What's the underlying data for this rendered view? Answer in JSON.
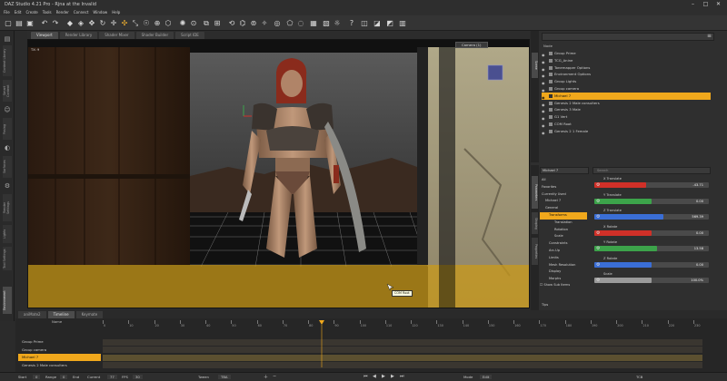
{
  "window": {
    "title": "DAZ Studio 4.21 Pro - Rjna at the Invalid",
    "controls": [
      "–",
      "□",
      "✕"
    ]
  },
  "menu": [
    "File",
    "Edit",
    "Create",
    "Tools",
    "Render",
    "Connect",
    "Window",
    "Help"
  ],
  "toolbar_icons": [
    "new-icon",
    "open-icon",
    "save-icon",
    "undo-icon",
    "redo-icon",
    "daz-icon",
    "lock-icon",
    "select-icon",
    "rotate-icon",
    "universal-icon",
    "translate-icon",
    "scale-icon",
    "pose-icon",
    "joint-icon",
    "geometry-icon",
    "light-icon",
    "camera-icon",
    "render-icon",
    "iray-icon",
    "help-icon"
  ],
  "viewport": {
    "tabs": [
      "Viewport",
      "Render Library",
      "Shader Mixer",
      "Shader Builder",
      "Script IDE"
    ],
    "active_tab": "Viewport",
    "corner_label": "TX: 9",
    "camera_selector": "Camera (1)",
    "tooltip": "COM Root"
  },
  "left_panel_tabs": [
    "Content Library",
    "Smart Content",
    "Posing",
    "Surfaces",
    "Render Settings",
    "Lights",
    "Tool Settings",
    "Environment"
  ],
  "scene": {
    "tab": "Scene",
    "header": "Node",
    "items": [
      {
        "label": "Group Prime",
        "selected": false
      },
      {
        "label": "TCG_Anine",
        "selected": false
      },
      {
        "label": "Tonemapper Options",
        "selected": false
      },
      {
        "label": "Environment Options",
        "selected": false
      },
      {
        "label": "Group Lights",
        "selected": false
      },
      {
        "label": "Group camera",
        "selected": false
      },
      {
        "label": "Michael 7",
        "selected": true
      },
      {
        "label": "Genesis 2 Male consulters",
        "selected": false
      },
      {
        "label": "Genesis 3 Male",
        "selected": false
      },
      {
        "label": "G1 Vert",
        "selected": false
      },
      {
        "label": "COM Root",
        "selected": false
      },
      {
        "label": "Genesis 2 1 Female",
        "selected": false
      }
    ]
  },
  "parameters": {
    "tab": "Parameters",
    "object": "Michael 7",
    "search_placeholder": "Search",
    "nav": [
      {
        "label": "All",
        "selected": false
      },
      {
        "label": "Favorites",
        "selected": false
      },
      {
        "label": "Currently Used",
        "selected": false
      },
      {
        "label": "Michael 7",
        "selected": false
      },
      {
        "label": "General",
        "selected": false
      },
      {
        "label": "Transforms",
        "selected": true
      },
      {
        "label": "Translation",
        "selected": false
      },
      {
        "label": "Rotation",
        "selected": false
      },
      {
        "label": "Scale",
        "selected": false
      },
      {
        "label": "Constraints",
        "selected": false
      },
      {
        "label": "Arc-Up",
        "selected": false
      },
      {
        "label": "Limits",
        "selected": false
      },
      {
        "label": "Mesh Resolution",
        "selected": false
      },
      {
        "label": "Display",
        "selected": false
      },
      {
        "label": "Morphs",
        "selected": false
      }
    ],
    "show_sub_items": "Show Sub Items",
    "props": [
      {
        "label": "X Translate",
        "value": "-43.71",
        "color": "#d03028",
        "fraction": 0.45
      },
      {
        "label": "Y Translate",
        "value": "0.00",
        "color": "#3ca34a",
        "fraction": 0.5
      },
      {
        "label": "Z Translate",
        "value": "569.39",
        "color": "#3a6ed6",
        "fraction": 0.6
      },
      {
        "label": "X Rotate",
        "value": "0.00",
        "color": "#d03028",
        "fraction": 0.5
      },
      {
        "label": "Y Rotate",
        "value": "13.58",
        "color": "#3ca34a",
        "fraction": 0.55
      },
      {
        "label": "Z Rotate",
        "value": "0.00",
        "color": "#3a6ed6",
        "fraction": 0.5
      },
      {
        "label": "Scale",
        "value": "100.0%",
        "color": "#9a9a9a",
        "fraction": 0.5
      }
    ],
    "footer": "Tips"
  },
  "timeline": {
    "tabs": [
      "aniMate2",
      "Timeline",
      "Keymate"
    ],
    "active_tab": "Timeline",
    "column_header": "Name",
    "rows": [
      {
        "label": "Group Prime",
        "selected": false
      },
      {
        "label": "Group camera",
        "selected": false
      },
      {
        "label": "Michael 7",
        "selected": true
      },
      {
        "label": "Genesis 2 Male consulters",
        "selected": false
      }
    ],
    "ticks": [
      "0",
      "10",
      "20",
      "30",
      "40",
      "50",
      "60",
      "70",
      "80",
      "90",
      "100",
      "110",
      "120",
      "130",
      "140",
      "150",
      "160",
      "170",
      "180",
      "190",
      "200",
      "210",
      "220",
      "230"
    ],
    "playhead_fraction": 0.37,
    "bottom": {
      "start_label": "Start",
      "start_value": "0",
      "range_label": "Range",
      "range_value": "0",
      "end_label": "End",
      "current_label": "Current",
      "current_value": "77",
      "fps_label": "FPS",
      "fps_value": "30",
      "tween_label": "Tween",
      "tween_value": "TBA",
      "mode_label": "Mode",
      "mode_value": "Edit",
      "tcb_label": "TCB"
    }
  }
}
